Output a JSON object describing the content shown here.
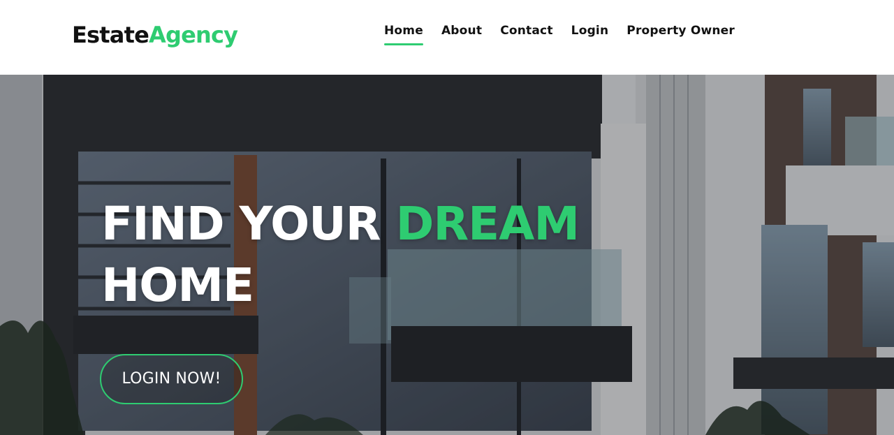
{
  "brand": {
    "name_primary": "Estate",
    "name_accent": "Agency"
  },
  "nav": {
    "items": [
      {
        "label": "Home",
        "active": true
      },
      {
        "label": "About"
      },
      {
        "label": "Contact"
      },
      {
        "label": "Login"
      },
      {
        "label": "Property Owner"
      }
    ]
  },
  "hero": {
    "headline_part1": "FIND YOUR ",
    "headline_accent": "DREAM",
    "headline_part2": "HOME",
    "cta_label": "LOGIN NOW!"
  },
  "colors": {
    "accent": "#2ecc71",
    "text": "#111111"
  }
}
